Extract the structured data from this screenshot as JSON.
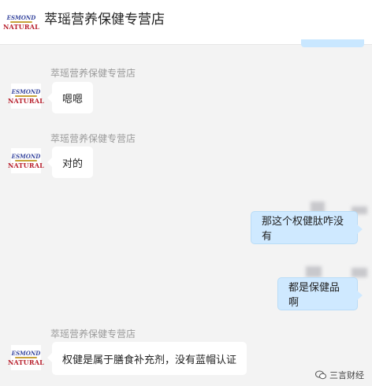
{
  "header": {
    "store_name": "萃瑶营养保健专营店",
    "logo_line1": "ESMOND",
    "logo_line2": "NATURAL"
  },
  "messages": [
    {
      "side": "left",
      "sender": "萃瑶营养保健专营店",
      "text": "嗯嗯"
    },
    {
      "side": "left",
      "sender": "萃瑶营养保健专营店",
      "text": "对的"
    },
    {
      "side": "right",
      "text": "那这个权健肽咋没有"
    },
    {
      "side": "right",
      "text": "都是保健品啊"
    },
    {
      "side": "left",
      "sender": "萃瑶营养保健专营店",
      "text": "权健是属于膳食补充剂，没有蓝帽认证"
    }
  ],
  "watermark": {
    "text": "三言财经",
    "icon": "wechat-icon"
  },
  "colors": {
    "right_bubble": "#cfe9ff",
    "left_bubble": "#ffffff",
    "background": "#f3f3f3"
  }
}
